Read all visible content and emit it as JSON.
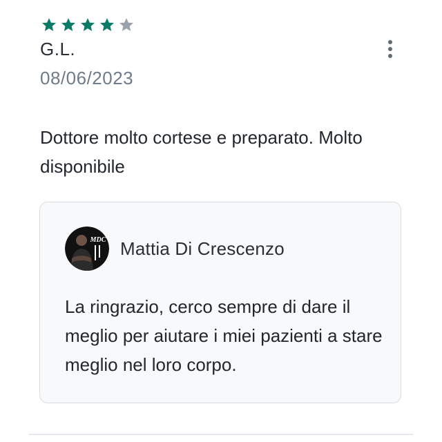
{
  "review": {
    "rating": 4,
    "max_rating": 5,
    "author": "G.L.",
    "date": "08/06/2023",
    "comment": "Dottore molto cortese e preparato. Molto disponibile"
  },
  "reply": {
    "doctor_name": "Mattia Di Crescenzo",
    "avatar_logo_text": "MDC",
    "text": "La ringrazio, cerco sempre di dare il meglio per aiutare i miei pazienti a stare meglio nel loro corpo."
  },
  "colors": {
    "star_filled": "#0b7a67",
    "star_empty": "#9aa2ab",
    "text_primary": "#22272e",
    "text_secondary": "#6f7b88"
  },
  "icons": {
    "rating": "star-icon",
    "menu": "more-vertical-icon"
  }
}
